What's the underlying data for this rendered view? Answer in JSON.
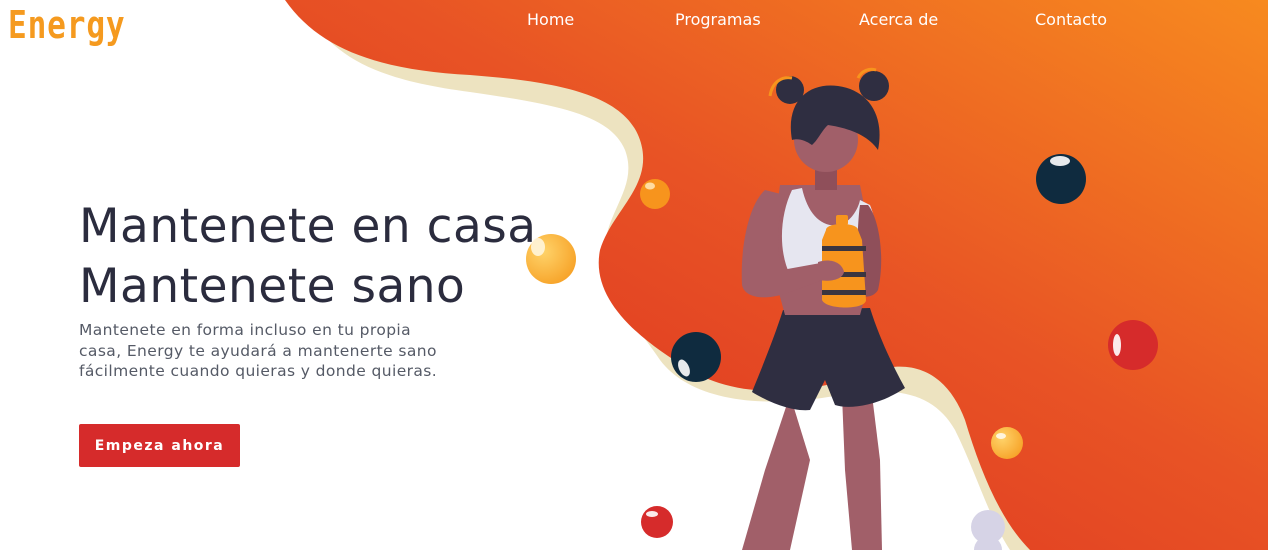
{
  "brand": {
    "logo_text": "Energy"
  },
  "nav": {
    "items": [
      {
        "label": "Home"
      },
      {
        "label": "Programas"
      },
      {
        "label": "Acerca de"
      },
      {
        "label": "Contacto"
      }
    ]
  },
  "hero": {
    "title_line1": "Mantenete en casa",
    "title_line2": "Mantenete sano",
    "description": "Mantenete en forma incluso en tu propia casa, Energy te ayudará a mantenerte sano fácilmente cuando quieras y donde quieras.",
    "cta_label": "Empeza ahora"
  },
  "colors": {
    "accent_orange": "#f7941d",
    "accent_red": "#dc3326",
    "cta_red": "#d62b2b",
    "text_dark": "#2b2c3e",
    "navy": "#0f2b3f"
  },
  "illustration": {
    "icon": "woman-holding-water-bottle-illustration"
  }
}
